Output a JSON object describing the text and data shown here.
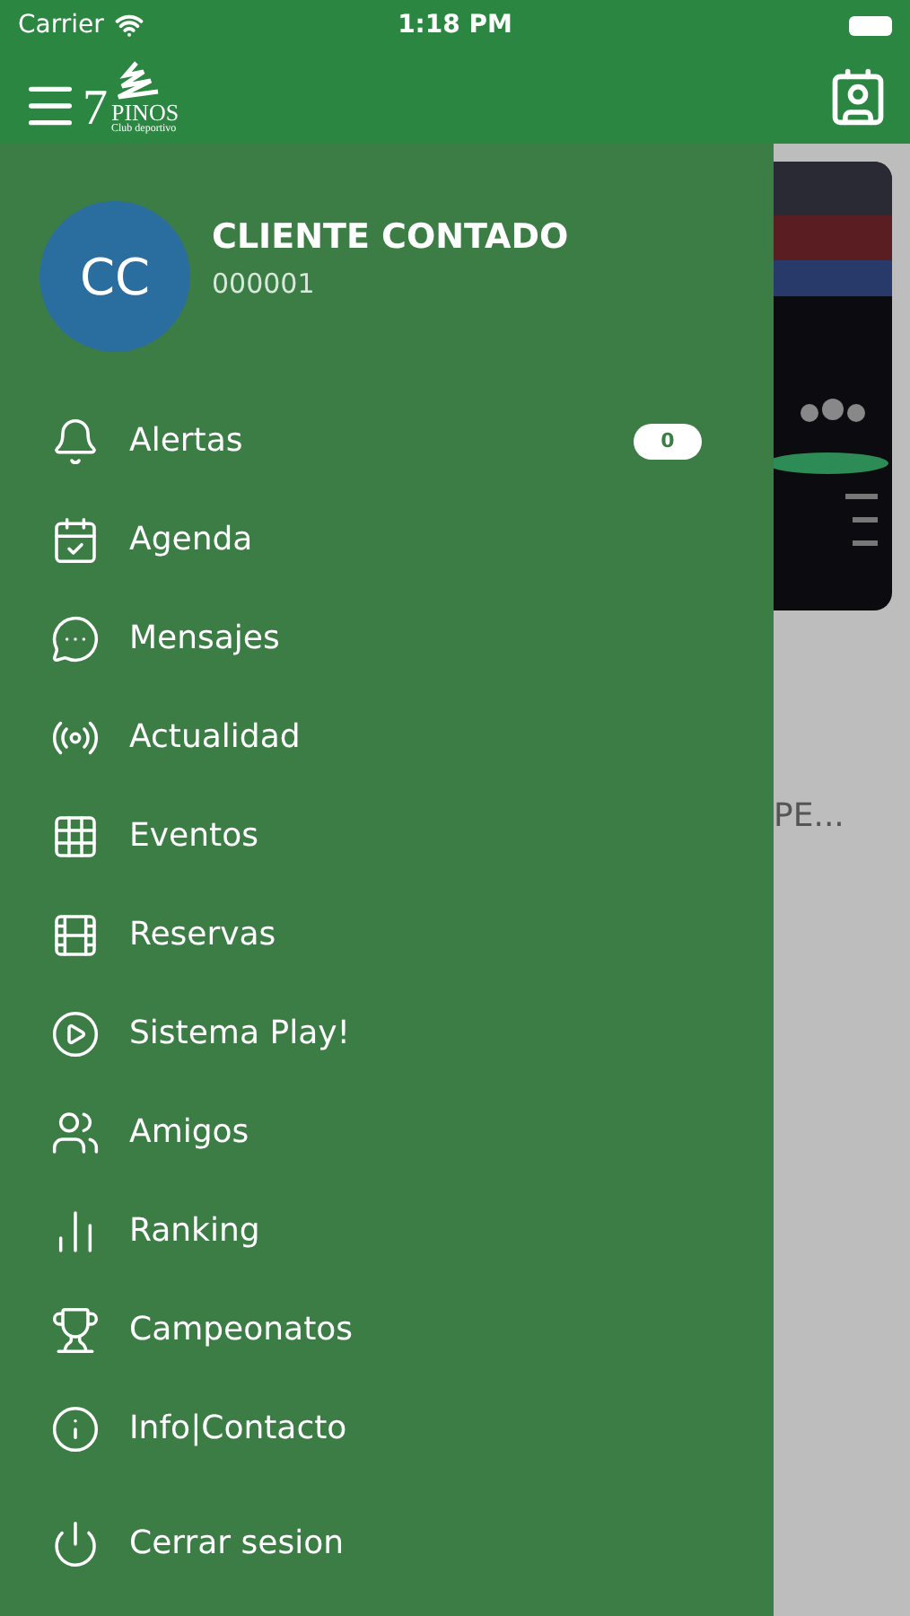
{
  "status_bar": {
    "carrier": "Carrier",
    "time": "1:18 PM"
  },
  "header": {
    "logo": {
      "number": "7",
      "name": "PINOS",
      "tagline": "Club deportivo"
    }
  },
  "background": {
    "snippet": "PE..."
  },
  "drawer": {
    "profile": {
      "initials": "CC",
      "name": "CLIENTE CONTADO",
      "code": "000001"
    },
    "items": [
      {
        "label": "Alertas",
        "badge": "0"
      },
      {
        "label": "Agenda"
      },
      {
        "label": "Mensajes"
      },
      {
        "label": "Actualidad"
      },
      {
        "label": "Eventos"
      },
      {
        "label": "Reservas"
      },
      {
        "label": "Sistema Play!"
      },
      {
        "label": "Amigos"
      },
      {
        "label": "Ranking"
      },
      {
        "label": "Campeonatos"
      },
      {
        "label": "Info|Contacto"
      }
    ],
    "logout": {
      "label": "Cerrar sesion"
    }
  }
}
